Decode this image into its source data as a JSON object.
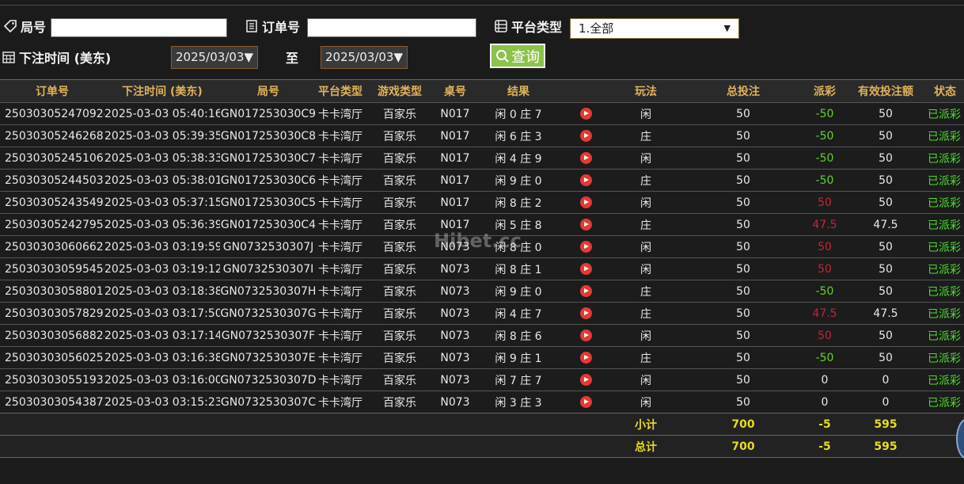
{
  "filters": {
    "round_label": "局号",
    "round_value": "",
    "order_label": "订单号",
    "order_value": "",
    "platform_label": "平台类型",
    "platform_selected": "1.全部",
    "bet_time_label": "下注时间 (美东)",
    "date_from": "2025/03/03▼",
    "to_label": "至",
    "date_to": "2025/03/03▼",
    "query_label": "查询"
  },
  "table": {
    "headers": [
      "订单号",
      "下注时间 (美东)",
      "局号",
      "平台类型",
      "游戏类型",
      "桌号",
      "结果",
      "",
      "玩法",
      "总投注",
      "派彩",
      "有效投注额",
      "状态"
    ],
    "rows": [
      {
        "order": "250303052470924",
        "time": "2025-03-03 05:40:16",
        "round": "GN017253030C9",
        "platform": "卡卡湾厅",
        "game": "百家乐",
        "table": "N017",
        "result": "闲 0 庄 7",
        "play": "闲",
        "bet": "50",
        "payout": "-50",
        "payout_color": "green",
        "valid": "50",
        "status": "已派彩"
      },
      {
        "order": "250303052462687",
        "time": "2025-03-03 05:39:35",
        "round": "GN017253030C8",
        "platform": "卡卡湾厅",
        "game": "百家乐",
        "table": "N017",
        "result": "闲 6 庄 3",
        "play": "庄",
        "bet": "50",
        "payout": "-50",
        "payout_color": "green",
        "valid": "50",
        "status": "已派彩"
      },
      {
        "order": "250303052451062",
        "time": "2025-03-03 05:38:33",
        "round": "GN017253030C7",
        "platform": "卡卡湾厅",
        "game": "百家乐",
        "table": "N017",
        "result": "闲 4 庄 9",
        "play": "闲",
        "bet": "50",
        "payout": "-50",
        "payout_color": "green",
        "valid": "50",
        "status": "已派彩"
      },
      {
        "order": "250303052445037",
        "time": "2025-03-03 05:38:01",
        "round": "GN017253030C6",
        "platform": "卡卡湾厅",
        "game": "百家乐",
        "table": "N017",
        "result": "闲 9 庄 0",
        "play": "庄",
        "bet": "50",
        "payout": "-50",
        "payout_color": "green",
        "valid": "50",
        "status": "已派彩"
      },
      {
        "order": "250303052435495",
        "time": "2025-03-03 05:37:15",
        "round": "GN017253030C5",
        "platform": "卡卡湾厅",
        "game": "百家乐",
        "table": "N017",
        "result": "闲 8 庄 2",
        "play": "闲",
        "bet": "50",
        "payout": "50",
        "payout_color": "red",
        "valid": "50",
        "status": "已派彩"
      },
      {
        "order": "250303052427958",
        "time": "2025-03-03 05:36:39",
        "round": "GN017253030C4",
        "platform": "卡卡湾厅",
        "game": "百家乐",
        "table": "N017",
        "result": "闲 5 庄 8",
        "play": "庄",
        "bet": "50",
        "payout": "47.5",
        "payout_color": "red",
        "valid": "47.5",
        "status": "已派彩"
      },
      {
        "order": "250303030606621",
        "time": "2025-03-03 03:19:59",
        "round": "GN0732530307J",
        "platform": "卡卡湾厅",
        "game": "百家乐",
        "table": "N073",
        "result": "闲 8 庄 0",
        "play": "闲",
        "bet": "50",
        "payout": "50",
        "payout_color": "red",
        "valid": "50",
        "status": "已派彩"
      },
      {
        "order": "250303030595450",
        "time": "2025-03-03 03:19:12",
        "round": "GN0732530307I",
        "platform": "卡卡湾厅",
        "game": "百家乐",
        "table": "N073",
        "result": "闲 8 庄 1",
        "play": "闲",
        "bet": "50",
        "payout": "50",
        "payout_color": "red",
        "valid": "50",
        "status": "已派彩"
      },
      {
        "order": "250303030588017",
        "time": "2025-03-03 03:18:38",
        "round": "GN0732530307H",
        "platform": "卡卡湾厅",
        "game": "百家乐",
        "table": "N073",
        "result": "闲 9 庄 0",
        "play": "庄",
        "bet": "50",
        "payout": "-50",
        "payout_color": "green",
        "valid": "50",
        "status": "已派彩"
      },
      {
        "order": "250303030578292",
        "time": "2025-03-03 03:17:50",
        "round": "GN0732530307G",
        "platform": "卡卡湾厅",
        "game": "百家乐",
        "table": "N073",
        "result": "闲 4 庄 7",
        "play": "庄",
        "bet": "50",
        "payout": "47.5",
        "payout_color": "red",
        "valid": "47.5",
        "status": "已派彩"
      },
      {
        "order": "250303030568824",
        "time": "2025-03-03 03:17:14",
        "round": "GN0732530307F",
        "platform": "卡卡湾厅",
        "game": "百家乐",
        "table": "N073",
        "result": "闲 8 庄 6",
        "play": "闲",
        "bet": "50",
        "payout": "50",
        "payout_color": "red",
        "valid": "50",
        "status": "已派彩"
      },
      {
        "order": "250303030560253",
        "time": "2025-03-03 03:16:38",
        "round": "GN0732530307E",
        "platform": "卡卡湾厅",
        "game": "百家乐",
        "table": "N073",
        "result": "闲 9 庄 1",
        "play": "庄",
        "bet": "50",
        "payout": "-50",
        "payout_color": "green",
        "valid": "50",
        "status": "已派彩"
      },
      {
        "order": "250303030551932",
        "time": "2025-03-03 03:16:00",
        "round": "GN0732530307D",
        "platform": "卡卡湾厅",
        "game": "百家乐",
        "table": "N073",
        "result": "闲 7 庄 7",
        "play": "闲",
        "bet": "50",
        "payout": "0",
        "payout_color": "white",
        "valid": "0",
        "status": "已派彩"
      },
      {
        "order": "250303030543872",
        "time": "2025-03-03 03:15:23",
        "round": "GN0732530307C",
        "platform": "卡卡湾厅",
        "game": "百家乐",
        "table": "N073",
        "result": "闲 3 庄 3",
        "play": "闲",
        "bet": "50",
        "payout": "0",
        "payout_color": "white",
        "valid": "0",
        "status": "已派彩"
      }
    ],
    "subtotal": {
      "label": "小计",
      "bet": "700",
      "payout": "-5",
      "valid": "595"
    },
    "total": {
      "label": "总计",
      "bet": "700",
      "payout": "-5",
      "valid": "595"
    }
  },
  "watermark": "Hibet.cc",
  "icons": {
    "round": "tag-icon",
    "order": "receipt-icon",
    "platform": "list-icon",
    "date": "calendar-icon",
    "query": "search-icon",
    "result_video": "play-icon"
  },
  "colors": {
    "header_text": "#e0b25a",
    "payout_loss": "#5fd32a",
    "payout_win": "#c0273a",
    "status": "#4cdc2c",
    "totals": "#e6dd1e",
    "query_button": "#8bc34a"
  }
}
